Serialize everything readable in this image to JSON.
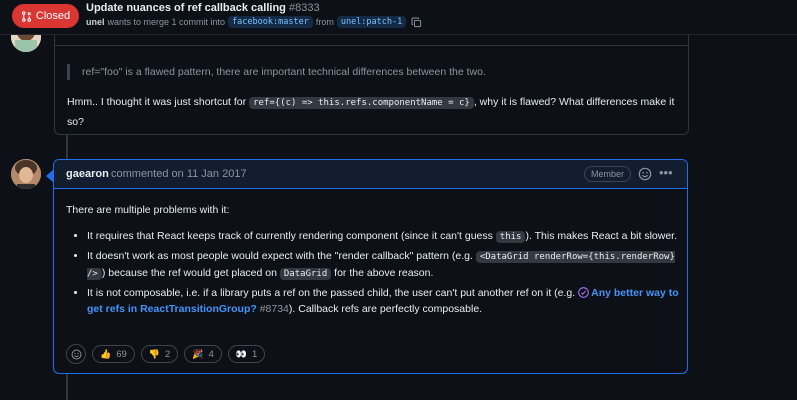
{
  "header": {
    "status": "Closed",
    "title": "Update nuances of ref callback calling",
    "number": "#8333",
    "author": "unel",
    "merge_text": "wants to merge 1 commit into",
    "base_branch": "facebook:master",
    "from_text": "from",
    "head_branch": "unel:patch-1"
  },
  "comment1": {
    "quote": "ref=\"foo\" is a flawed pattern, there are important technical differences between the two.",
    "body_before": "Hmm.. I thought it was just shortcut for ",
    "code": "ref={(c) => this.refs.componentName = c}",
    "body_after": ", why it is flawed? What differences make it so?"
  },
  "comment2": {
    "author": "gaearon",
    "commented_text": "commented on 11 Jan 2017",
    "role": "Member",
    "intro": "There are multiple problems with it:",
    "b1_a": "It requires that React keeps track of currently rendering component (since it can't guess ",
    "b1_code": "this",
    "b1_b": "). This makes React a bit slower.",
    "b2_a": "It doesn't work as most people would expect with the \"render callback\" pattern (e.g. ",
    "b2_code1": "<DataGrid renderRow={this.renderRow} />",
    "b2_b": ") because the ref would get placed on ",
    "b2_code2": "DataGrid",
    "b2_c": " for the above reason.",
    "b3_a": "It is not composable, i.e. if a library puts a ref on the passed child, the user can't put another ref on it (e.g. ",
    "b3_link": "Any better way to get refs in ReactTransitionGroup?",
    "b3_ref": "#8734",
    "b3_b": "). Callback refs are perfectly composable.",
    "reactions": [
      {
        "emoji": "👍",
        "count": "69"
      },
      {
        "emoji": "👎",
        "count": "2"
      },
      {
        "emoji": "🎉",
        "count": "4"
      },
      {
        "emoji": "👀",
        "count": "1"
      }
    ]
  },
  "colors": {
    "closed": "#da3633",
    "accent": "#1f6feb",
    "link": "#4493f8",
    "merged_purple": "#a371f7"
  }
}
